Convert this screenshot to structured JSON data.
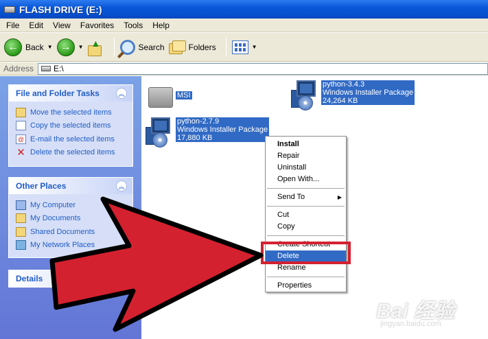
{
  "window": {
    "title": "FLASH DRIVE (E:)"
  },
  "menubar": {
    "items": [
      "File",
      "Edit",
      "View",
      "Favorites",
      "Tools",
      "Help"
    ]
  },
  "toolbar": {
    "back_label": "Back",
    "search_label": "Search",
    "folders_label": "Folders"
  },
  "address": {
    "label": "Address",
    "value": "E:\\"
  },
  "left_pane": {
    "file_tasks": {
      "header": "File and Folder Tasks",
      "items": [
        "Move the selected items",
        "Copy the selected items",
        "E-mail the selected items",
        "Delete the selected items"
      ]
    },
    "other_places": {
      "header": "Other Places",
      "items": [
        "My Computer",
        "My Documents",
        "Shared Documents",
        "My Network Places"
      ]
    },
    "details": {
      "header": "Details"
    }
  },
  "files": [
    {
      "name": "MSI",
      "lines": [
        "MSI"
      ]
    },
    {
      "name": "python-3.4.3",
      "lines": [
        "python-3.4.3",
        "Windows Installer Package",
        "24,264 KB"
      ]
    },
    {
      "name": "python-2.7.9",
      "lines": [
        "python-2.7.9",
        "Windows Installer Package",
        "17,880 KB"
      ]
    }
  ],
  "context_menu": {
    "items": [
      "Install",
      "Repair",
      "Uninstall",
      "Open With...",
      "Send To",
      "Cut",
      "Copy",
      "Create Shortcut",
      "Delete",
      "Rename",
      "Properties"
    ],
    "selected": "Delete"
  },
  "watermark": {
    "brand": "Bai 经验",
    "url": "jingyan.baidu.com"
  },
  "colors": {
    "arrow": "#d4212f",
    "selection": "#316ac5",
    "link": "#215dc6"
  }
}
